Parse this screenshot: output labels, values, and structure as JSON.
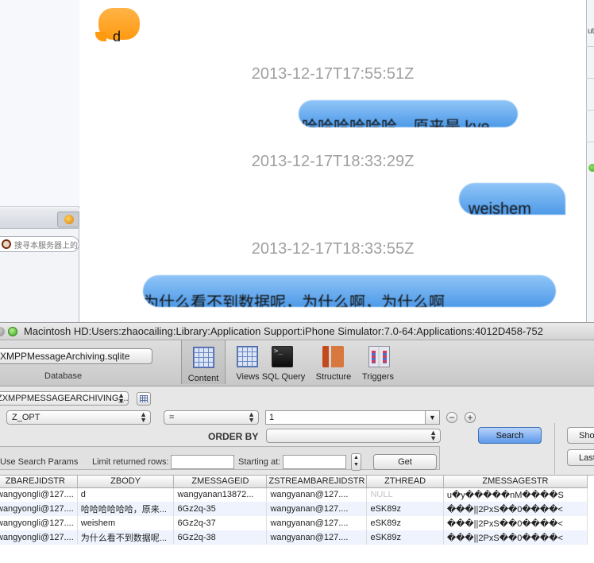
{
  "background": {
    "left_search_placeholder": "搜寻本服务器上的",
    "right_fragment": "ut"
  },
  "chat": {
    "messages": [
      {
        "direction": "incoming",
        "text": "d"
      },
      {
        "timestamp": "2013-12-17T17:55:51Z"
      },
      {
        "direction": "outgoing",
        "text": "哈哈哈哈哈哈，原来是 kye"
      },
      {
        "timestamp": "2013-12-17T18:33:29Z"
      },
      {
        "direction": "outgoing",
        "text": "weishem"
      },
      {
        "timestamp": "2013-12-17T18:33:55Z"
      },
      {
        "direction": "outgoing",
        "text": "为什么看不到数据呢，为什么啊，为什么啊"
      }
    ],
    "colors": {
      "incoming": "#ff9a10",
      "outgoing": "#4e9ae8",
      "timestamp": "#a0a0a0"
    }
  },
  "sqlite": {
    "window_title": "Macintosh HD:Users:zhaocailing:Library:Application Support:iPhone Simulator:7.0-64:Applications:4012D458-752",
    "database_file": "XMPPMessageArchiving.sqlite",
    "database_label": "Database",
    "toolbar": {
      "content": "Content",
      "views": "Views",
      "sql_query": "SQL Query",
      "structure": "Structure",
      "triggers": "Triggers"
    },
    "terminal_icon_text": ">_",
    "filter": {
      "table": "ZXMPPMESSAGEARCHIVING_...",
      "field": "Z_OPT",
      "operator": "=",
      "value": "1",
      "order_by_label": "ORDER BY",
      "order_by_value": "",
      "search_button": "Search",
      "use_search_params": "Use Search Params",
      "limit_label": "Limit returned rows:",
      "limit_value": "",
      "starting_at_label": "Starting at:",
      "starting_at_value": "",
      "get_button": "Get",
      "show_button": "Show",
      "last_button": "Last"
    },
    "table": {
      "columns": [
        "ZBAREJIDSTR",
        "ZBODY",
        "ZMESSAGEID",
        "ZSTREAMBAREJIDSTR",
        "ZTHREAD",
        "ZMESSAGESTR"
      ],
      "rows": [
        [
          "wangyongli@127....",
          "d",
          "wangyanan13872...",
          "wangyanan@127....",
          "NULL",
          "u�y�����nM����S"
        ],
        [
          "wangyongli@127....",
          "哈哈哈哈哈哈，原来...",
          "6Gz2q-35",
          "wangyanan@127....",
          "eSK89z",
          "���||2PxS��0����<"
        ],
        [
          "wangyongli@127....",
          "weishem",
          "6Gz2q-37",
          "wangyanan@127....",
          "eSK89z",
          "���||2PxS��0����<"
        ],
        [
          "wangyongli@127....",
          "为什么看不到数据呢...",
          "6Gz2q-38",
          "wangyanan@127....",
          "eSK89z",
          "���||2PxS��0����<"
        ]
      ]
    }
  }
}
